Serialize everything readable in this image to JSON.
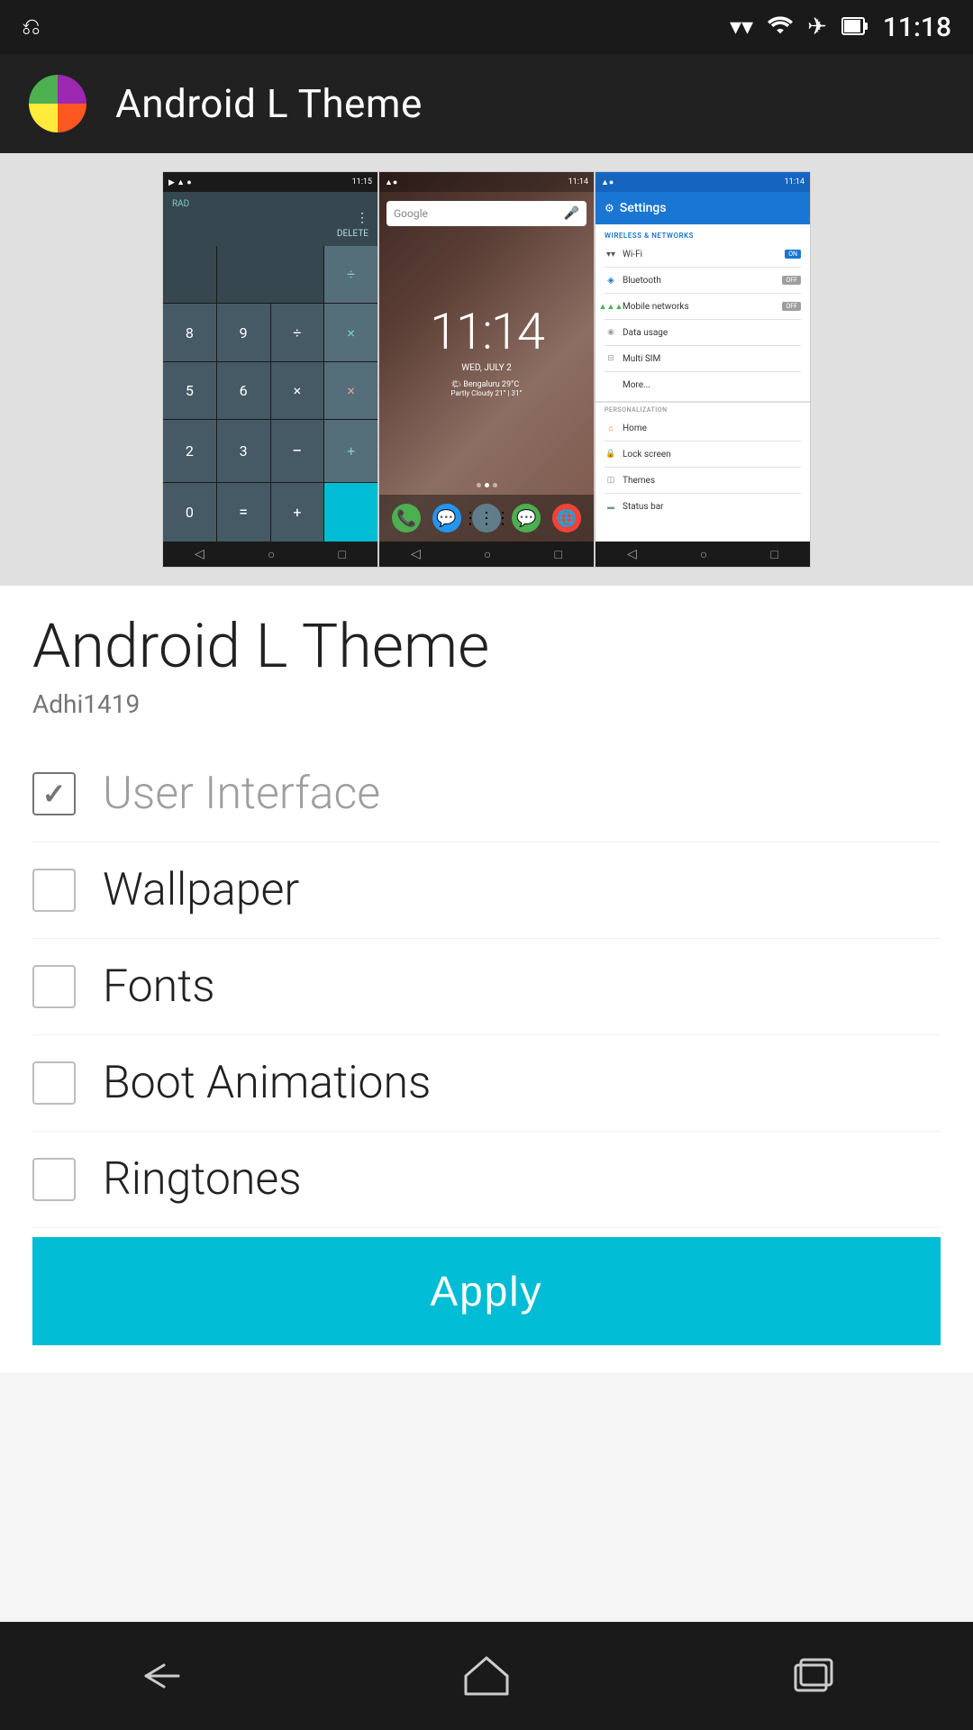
{
  "statusBar": {
    "time": "11:18",
    "icons": {
      "usb": "⎋",
      "wifi": "wifi",
      "airplane": "✈",
      "battery": "battery"
    }
  },
  "appBar": {
    "title": "Android L Theme",
    "logoColors": {
      "topLeft": "#4CAF50",
      "topRight": "#9C27B0",
      "bottomLeft": "#FFEB3B",
      "bottomRight": "#FF5722"
    }
  },
  "screenshots": [
    {
      "type": "calculator",
      "time": "11:15",
      "label": "RAD"
    },
    {
      "type": "homescreen",
      "time": "11:14",
      "clockTime": "11:14",
      "date": "WED, JULY 2",
      "weather": "Bengaluru  29°C",
      "weatherSub": "Partly Cloudy   21° | 31°"
    },
    {
      "type": "settings",
      "time": "11:14",
      "headerTitle": "Settings",
      "sections": {
        "wireless": "WIRELESS & NETWORKS",
        "personalization": "PERSONALIZATION"
      },
      "items": [
        {
          "icon": "wifi",
          "text": "Wi-Fi",
          "toggle": "ON",
          "on": true
        },
        {
          "icon": "bluetooth",
          "text": "Bluetooth",
          "toggle": "OFF",
          "on": false
        },
        {
          "icon": "signal",
          "text": "Mobile networks",
          "toggle": "OFF",
          "on": false
        },
        {
          "icon": "data",
          "text": "Data usage",
          "toggle": null
        },
        {
          "icon": "sim",
          "text": "Multi SIM",
          "toggle": null
        },
        {
          "icon": "more",
          "text": "More...",
          "toggle": null
        },
        {
          "icon": "home",
          "text": "Home",
          "toggle": null
        },
        {
          "icon": "lock",
          "text": "Lock screen",
          "toggle": null
        },
        {
          "icon": "themes",
          "text": "Themes",
          "toggle": null
        },
        {
          "icon": "status",
          "text": "Status bar",
          "toggle": null
        }
      ]
    }
  ],
  "themeDetail": {
    "title": "Android L Theme",
    "author": "Adhi1419",
    "checkboxes": [
      {
        "id": "ui",
        "label": "User Interface",
        "checked": true
      },
      {
        "id": "wallpaper",
        "label": "Wallpaper",
        "checked": false
      },
      {
        "id": "fonts",
        "label": "Fonts",
        "checked": false
      },
      {
        "id": "bootAnimations",
        "label": "Boot Animations",
        "checked": false
      },
      {
        "id": "ringtones",
        "label": "Ringtones",
        "checked": false
      }
    ],
    "applyButton": "Apply"
  },
  "bottomNav": {
    "back": "←",
    "home": "⌂",
    "recents": "▭"
  }
}
